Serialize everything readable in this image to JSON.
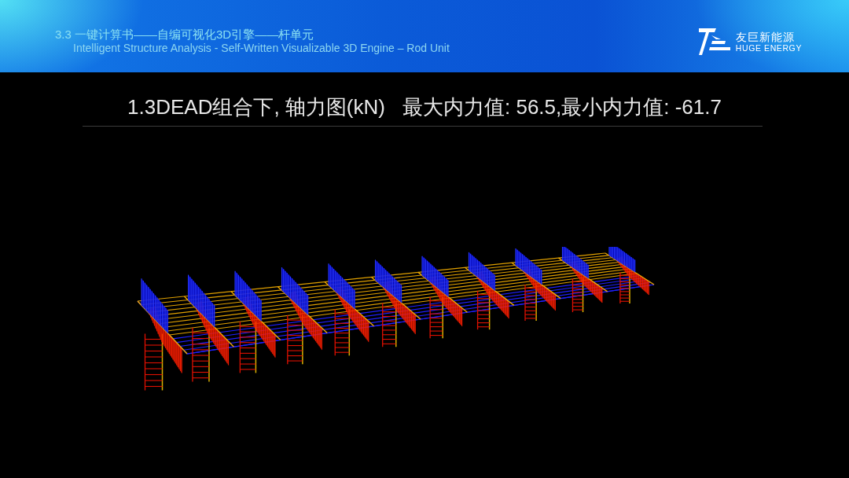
{
  "header": {
    "title": "3.3 一键计算书——自编可视化3D引擎——杆单元",
    "subtitle": "Intelligent Structure Analysis  - Self-Written Visualizable 3D Engine – Rod Unit",
    "logo": {
      "name": "友巨新能源",
      "name_en": "HUGE ENERGY"
    }
  },
  "viewer": {
    "caption": "1.3DEAD组合下, 轴力图(kN)",
    "range": "最大内力值: 56.5,最小内力值: -61.7"
  }
}
